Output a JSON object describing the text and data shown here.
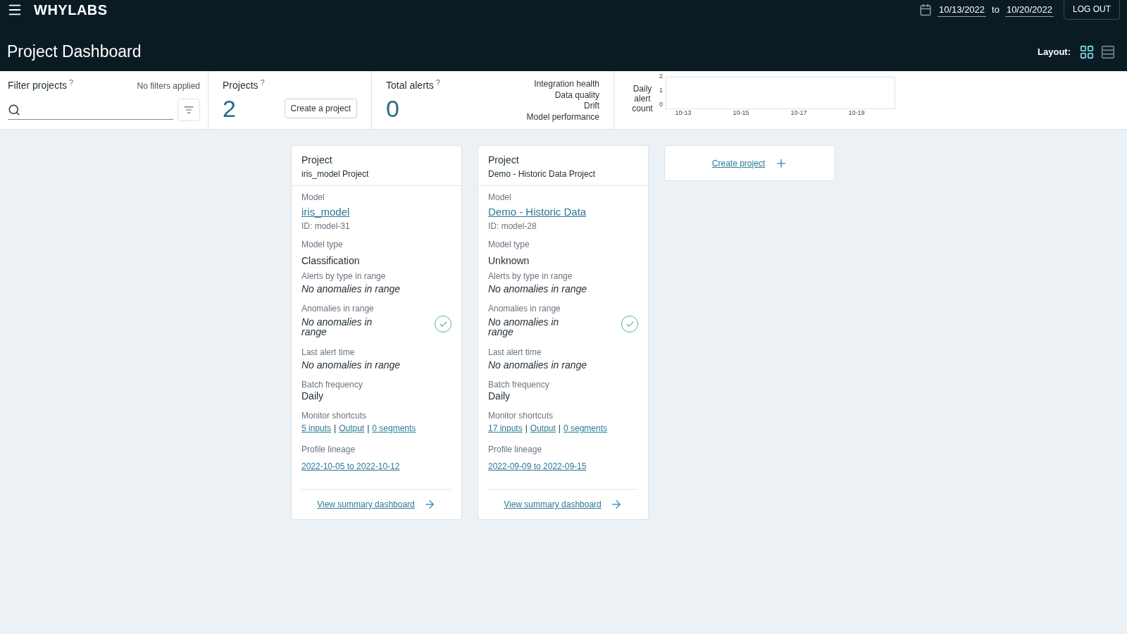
{
  "header": {
    "logo": "WHYLABS",
    "date_from": "10/13/2022",
    "date_sep": "to",
    "date_to": "10/20/2022",
    "logout": "LOG OUT",
    "title": "Project Dashboard",
    "layout_label": "Layout:",
    "layouts": [
      {
        "kind": "grid",
        "selected": true
      },
      {
        "kind": "list",
        "selected": false
      }
    ]
  },
  "filter": {
    "title": "Filter projects",
    "help": "?",
    "status": "No filters applied"
  },
  "projects_panel": {
    "title": "Projects",
    "help": "?",
    "count": "2",
    "button": "Create a project"
  },
  "alerts_panel": {
    "title": "Total alerts",
    "help": "?",
    "count": "0",
    "types": [
      "Integration health",
      "Data quality",
      "Drift",
      "Model performance"
    ]
  },
  "chart_panel": {
    "label": "Daily alert count",
    "y_labels": [
      "2",
      "1",
      "0"
    ],
    "x_labels": [
      "10-13",
      "10-15",
      "10-17",
      "10-19"
    ]
  },
  "cards": [
    {
      "heading": "Project",
      "project": "iris_model Project",
      "model_label": "Model",
      "model": "iris_model",
      "id": "ID: model-31",
      "type_label": "Model type",
      "type": "Classification",
      "alerts_label": "Alerts by type in range",
      "alerts": "No anomalies in range",
      "anom_label": "Anomalies in range",
      "anom": "No anomalies in range",
      "healthy": true,
      "last_label": "Last alert time",
      "last": "No anomalies in range",
      "batch_label": "Batch frequency",
      "batch": "Daily",
      "shortcuts_label": "Monitor shortcuts",
      "shortcuts": [
        "5 inputs",
        "Output",
        "0 segments"
      ],
      "sep": "|",
      "lineage_label": "Profile lineage",
      "lineage": "2022-10-05 to 2022-10-12",
      "summary": "View summary dashboard"
    },
    {
      "heading": "Project",
      "project": "Demo - Historic Data Project",
      "model_label": "Model",
      "model": "Demo - Historic Data",
      "id": "ID: model-28",
      "type_label": "Model type",
      "type": "Unknown",
      "alerts_label": "Alerts by type in range",
      "alerts": "No anomalies in range",
      "anom_label": "Anomalies in range",
      "anom": "No anomalies in range",
      "healthy": true,
      "last_label": "Last alert time",
      "last": "No anomalies in range",
      "batch_label": "Batch frequency",
      "batch": "Daily",
      "shortcuts_label": "Monitor shortcuts",
      "shortcuts": [
        "17 inputs",
        "Output",
        "0 segments"
      ],
      "sep": "|",
      "lineage_label": "Profile lineage",
      "lineage": "2022-09-09 to 2022-09-15",
      "summary": "View summary dashboard"
    }
  ],
  "create_card": {
    "label": "Create project"
  }
}
